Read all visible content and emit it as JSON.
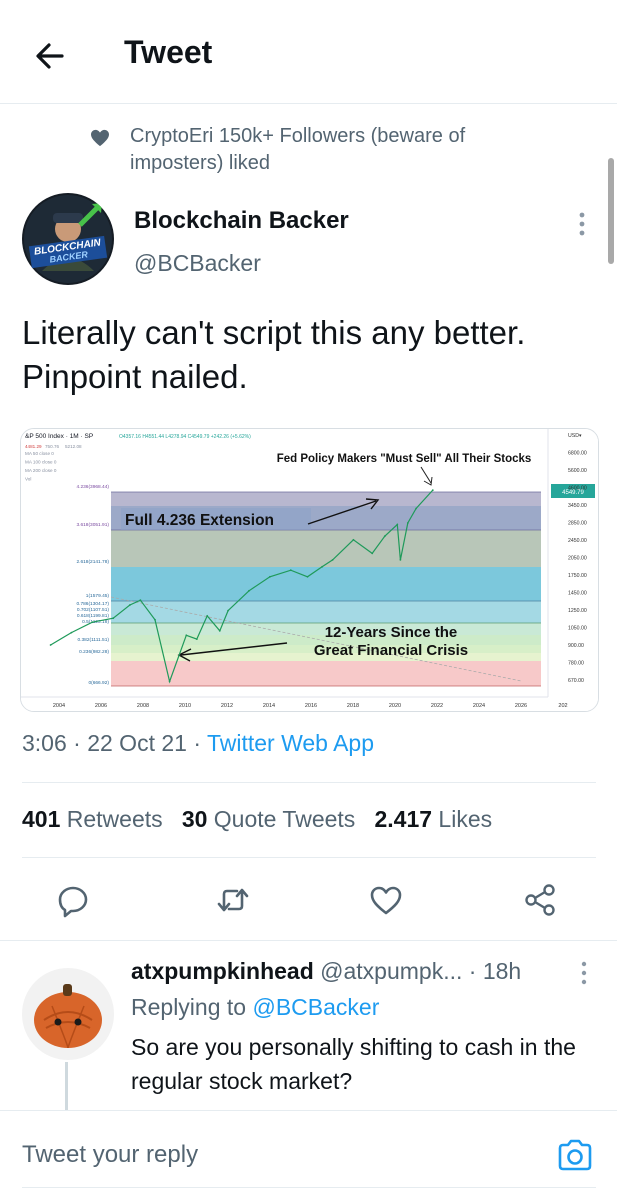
{
  "header": {
    "title": "Tweet",
    "back_icon": "back-arrow-icon"
  },
  "social_context": {
    "icon": "heart-icon",
    "text": "CryptoEri 150k+ Followers (beware of imposters) liked"
  },
  "tweet": {
    "author_name": "Blockchain Backer",
    "author_handle": "@BCBacker",
    "avatar_label": "BLOCKCHAIN BACKER",
    "text": "Literally can't script this any better. Pinpoint nailed.",
    "timestamp": "3:06 · 22 Oct 21 · ",
    "source_app": "Twitter Web App"
  },
  "stats": {
    "retweets_count": "401",
    "retweets_label": "Retweets",
    "quotes_count": "30",
    "quotes_label": "Quote Tweets",
    "likes_count": "2.417",
    "likes_label": "Likes"
  },
  "actions": {
    "reply_icon": "reply-icon",
    "retweet_icon": "retweet-icon",
    "like_icon": "heart-outline-icon",
    "share_icon": "share-icon"
  },
  "chart_data": {
    "type": "line",
    "title_label": "&P 500 Index · 1M · SP",
    "ohlc": "O4357.16 H4551.44 L4278.94 C4549.79 +242.26 (+5.62%)",
    "annotations": {
      "top": "Fed Policy Makers \"Must Sell\" All Their Stocks",
      "extension": "Full 4.236 Extension",
      "crisis_line1": "12-Years Since the",
      "crisis_line2": "Great Financial Crisis"
    },
    "x_ticks": [
      "2004",
      "2006",
      "2008",
      "2010",
      "2012",
      "2014",
      "2016",
      "2018",
      "2020",
      "2022",
      "2024",
      "2026",
      "202"
    ],
    "y_ticks": [
      "USD▾",
      "6800.00",
      "5600.00",
      "4600.00",
      "3450.00",
      "2850.00",
      "2450.00",
      "2050.00",
      "1750.00",
      "1450.00",
      "1250.00",
      "1050.00",
      "900.00",
      "780.00",
      "670.00"
    ],
    "price_tag": "4549.79",
    "fib_levels": [
      "4.236(3968.44)",
      "3.618(3051.91)",
      "2.618(2141.78)",
      "1(1579.45)",
      "0.786(1304.17)",
      "0.702(1107.51)",
      "0.618(1199.81)",
      "0.5(1123.18)",
      "0.382(1111.51)",
      "0.236(982.28)",
      "0(666.92)"
    ],
    "legend_rows": [
      "4481.29",
      "750.76",
      "5212.08",
      "MA 50 close 0",
      "MA 100 close 0",
      "MA 200 close 0",
      "Vol"
    ],
    "x": [
      2003.5,
      2004.5,
      2005.5,
      2006.5,
      2007.3,
      2007.8,
      2008.5,
      2009.2,
      2010.0,
      2010.5,
      2011.0,
      2011.6,
      2012.0,
      2013.0,
      2014.0,
      2015.0,
      2015.8,
      2016.5,
      2017.0,
      2018.0,
      2018.9,
      2019.5,
      2020.1,
      2020.25,
      2020.6,
      2021.0,
      2021.8
    ],
    "y": [
      1000,
      1130,
      1250,
      1300,
      1480,
      1550,
      1280,
      700,
      1100,
      1060,
      1330,
      1150,
      1400,
      1700,
      1950,
      2080,
      1950,
      2150,
      2300,
      2800,
      2450,
      2900,
      3250,
      2300,
      3300,
      3800,
      4550
    ]
  },
  "reply": {
    "author_name": "atxpumpkinhead",
    "author_handle": "@atxpumpk...",
    "time": "· 18h",
    "replying_to_label": "Replying to ",
    "replying_to_handle": "@BCBacker",
    "text": "So are you personally shifting to cash in the regular stock market?"
  },
  "composer": {
    "placeholder": "Tweet your reply",
    "camera_icon": "camera-icon"
  },
  "colors": {
    "accent": "#1d9bf0",
    "secondary_text": "#536471",
    "divider": "#e6ecf0"
  }
}
